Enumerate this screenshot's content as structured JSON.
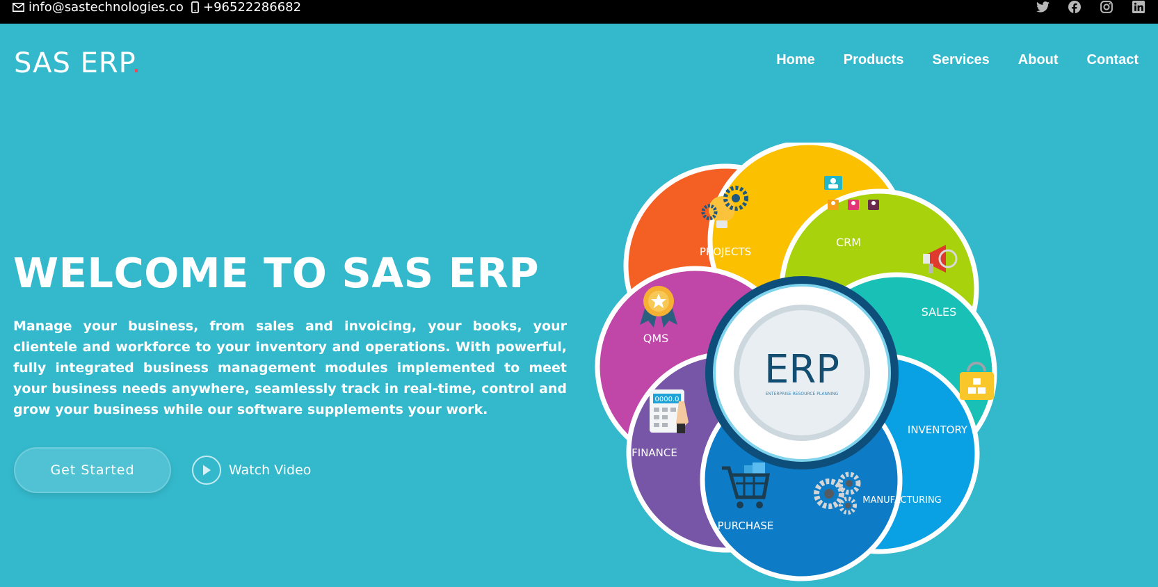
{
  "topbar": {
    "email": "info@sastechnologies.co",
    "phone": "+96522286682",
    "email_icon": "envelope-icon",
    "phone_icon": "mobile-phone-icon",
    "social": [
      {
        "name": "twitter-icon"
      },
      {
        "name": "facebook-icon"
      },
      {
        "name": "instagram-icon"
      },
      {
        "name": "linkedin-icon"
      }
    ]
  },
  "brand": {
    "name": "SAS ERP",
    "dot": ".",
    "dot_color": "#f2465d"
  },
  "nav": {
    "items": [
      "Home",
      "Products",
      "Services",
      "About",
      "Contact"
    ]
  },
  "hero": {
    "title": "WELCOME TO SAS ERP",
    "description": "Manage your business, from sales and invoicing, your books, your clientele and workforce to your inventory and operations. With powerful, fully integrated business management modules implemented to meet your business needs anywhere, seamlessly track in real-time, control and grow your business while our software supplements your work.",
    "primary_button": "Get Started",
    "video_button": "Watch Video",
    "video_icon": "play-icon"
  },
  "erp_graphic": {
    "center_title": "ERP",
    "center_subtitle": "ENTERPRISE RESOURCE PLANNING",
    "modules": {
      "projects": "PROJECTS",
      "crm": "CRM",
      "sales": "SALES",
      "inventory": "INVENTORY",
      "manufacturing": "MANUFACTURING",
      "purchase": "PURCHASE",
      "finance": "FINANCE",
      "qms": "QMS"
    },
    "calculator_display": "0000.0"
  },
  "colors": {
    "background": "#34b9cc",
    "topbar": "#000000",
    "text": "#ffffff",
    "projects": "#f46024",
    "crm": "#fbc000",
    "sales": "#a8d20c",
    "inventory": "#18c0b6",
    "manufacturing": "#0aa1e4",
    "purchase": "#0e7bc6",
    "finance": "#7756a8",
    "qms": "#c046a8",
    "center_ring": "#0d4f7a"
  }
}
